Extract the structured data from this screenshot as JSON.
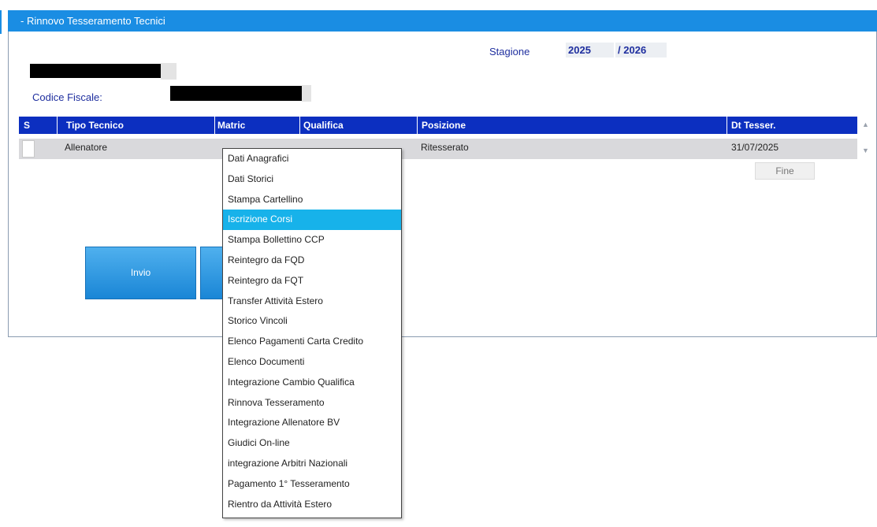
{
  "window": {
    "title": "- Rinnovo Tesseramento Tecnici"
  },
  "season": {
    "label": "Stagione",
    "from": "2025",
    "separator": "/",
    "to": "2026"
  },
  "person": {
    "codice_fiscale_label": "Codice Fiscale:"
  },
  "grid": {
    "columns": [
      "S",
      "Tipo Tecnico",
      "Matric",
      "Qualifica",
      "Posizione",
      "Dt Tesser."
    ],
    "rows": [
      {
        "tipo_tecnico": "Allenatore",
        "posizione": "Ritesserato",
        "dt_tesser": "31/07/2025"
      }
    ]
  },
  "buttons": {
    "invio": "Invio",
    "fine": "Fine"
  },
  "context_menu": {
    "highlighted_index": 3,
    "items": [
      "Dati Anagrafici",
      "Dati Storici",
      "Stampa Cartellino",
      "Iscrizione Corsi",
      "Stampa Bollettino CCP",
      "Reintegro da FQD",
      "Reintegro da FQT",
      "Transfer Attività Estero",
      "Storico Vincoli",
      "Elenco Pagamenti Carta Credito",
      "Elenco Documenti",
      "Integrazione Cambio Qualifica",
      "Rinnova Tesseramento",
      "Integrazione Allenatore BV",
      "Giudici On-line",
      "integrazione Arbitri Nazionali",
      "Pagamento 1° Tesseramento",
      "Rientro da Attività Estero"
    ]
  },
  "colors": {
    "titlebar": "#1a8de3",
    "grid_header": "#0c2fc0",
    "menu_highlight": "#17b2ea"
  }
}
